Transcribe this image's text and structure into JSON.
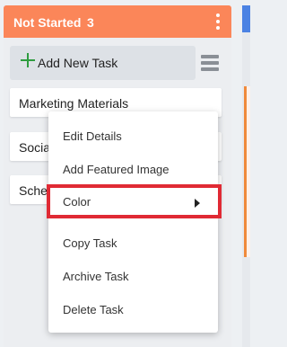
{
  "column": {
    "title": "Not Started",
    "count": "3",
    "header_color": "#fb8659",
    "add_task_label": "Add New Task"
  },
  "cards": [
    {
      "title": "Marketing Materials"
    },
    {
      "title": "Social"
    },
    {
      "title": "Sche"
    }
  ],
  "context_menu": {
    "items": [
      {
        "label": "Edit Details"
      },
      {
        "label": "Add Featured Image"
      },
      {
        "label": "Color",
        "has_submenu": true,
        "highlighted": true
      },
      {
        "label": "Copy Task"
      },
      {
        "label": "Archive Task"
      },
      {
        "label": "Delete Task"
      }
    ],
    "highlight_color": "#e02a34"
  },
  "icons": {
    "add": "plus-icon",
    "column_menu": "kebab-menu-icon",
    "list_view": "list-view-icon",
    "submenu": "caret-right-icon"
  }
}
